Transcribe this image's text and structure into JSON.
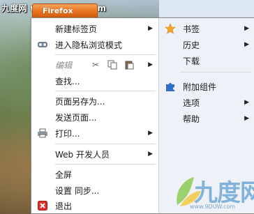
{
  "watermark": {
    "top_text": "九度网 www.9duw.com",
    "logo_text": "九度网",
    "logo_url": "www.9DUW.com"
  },
  "firefox_button": {
    "label": "Firefox"
  },
  "left_menu": [
    {
      "id": "new-tab",
      "label": "新建标签页",
      "has_submenu": true,
      "icon": ""
    },
    {
      "id": "private",
      "label": "进入隐私浏览模式",
      "has_submenu": false,
      "icon": "private-browsing-mask-icon"
    },
    {
      "id": "edit",
      "label": "编辑",
      "has_submenu": true,
      "disabled": true,
      "icon": ""
    },
    {
      "id": "find",
      "label": "查找...",
      "has_submenu": false,
      "icon": ""
    },
    {
      "id": "save-page",
      "label": "页面另存为...",
      "has_submenu": false,
      "icon": ""
    },
    {
      "id": "send-link",
      "label": "发送页面...",
      "has_submenu": false,
      "icon": ""
    },
    {
      "id": "print",
      "label": "打印...",
      "has_submenu": true,
      "icon": "printer-icon"
    },
    {
      "id": "web-dev",
      "label": "Web 开发人员",
      "has_submenu": true,
      "icon": ""
    },
    {
      "id": "fullscreen",
      "label": "全屏",
      "has_submenu": false,
      "icon": ""
    },
    {
      "id": "sync",
      "label": "设置 同步...",
      "has_submenu": false,
      "icon": ""
    },
    {
      "id": "exit",
      "label": "退出",
      "has_submenu": false,
      "icon": "exit-icon"
    }
  ],
  "right_menu": [
    {
      "id": "bookmarks",
      "label": "书签",
      "has_submenu": true,
      "icon": "star-icon"
    },
    {
      "id": "history",
      "label": "历史",
      "has_submenu": true,
      "icon": ""
    },
    {
      "id": "downloads",
      "label": "下载",
      "has_submenu": false,
      "icon": ""
    },
    {
      "id": "addons",
      "label": "附加组件",
      "has_submenu": false,
      "icon": "puzzle-piece-icon"
    },
    {
      "id": "options",
      "label": "选项",
      "has_submenu": true,
      "icon": ""
    },
    {
      "id": "help",
      "label": "帮助",
      "has_submenu": true,
      "icon": ""
    }
  ],
  "colors": {
    "firefox_orange": "#e8731f",
    "right_column_bg": "#eef2f8",
    "star": "#f5a623",
    "puzzle": "#2f6fc9",
    "exit": "#d9302a"
  }
}
